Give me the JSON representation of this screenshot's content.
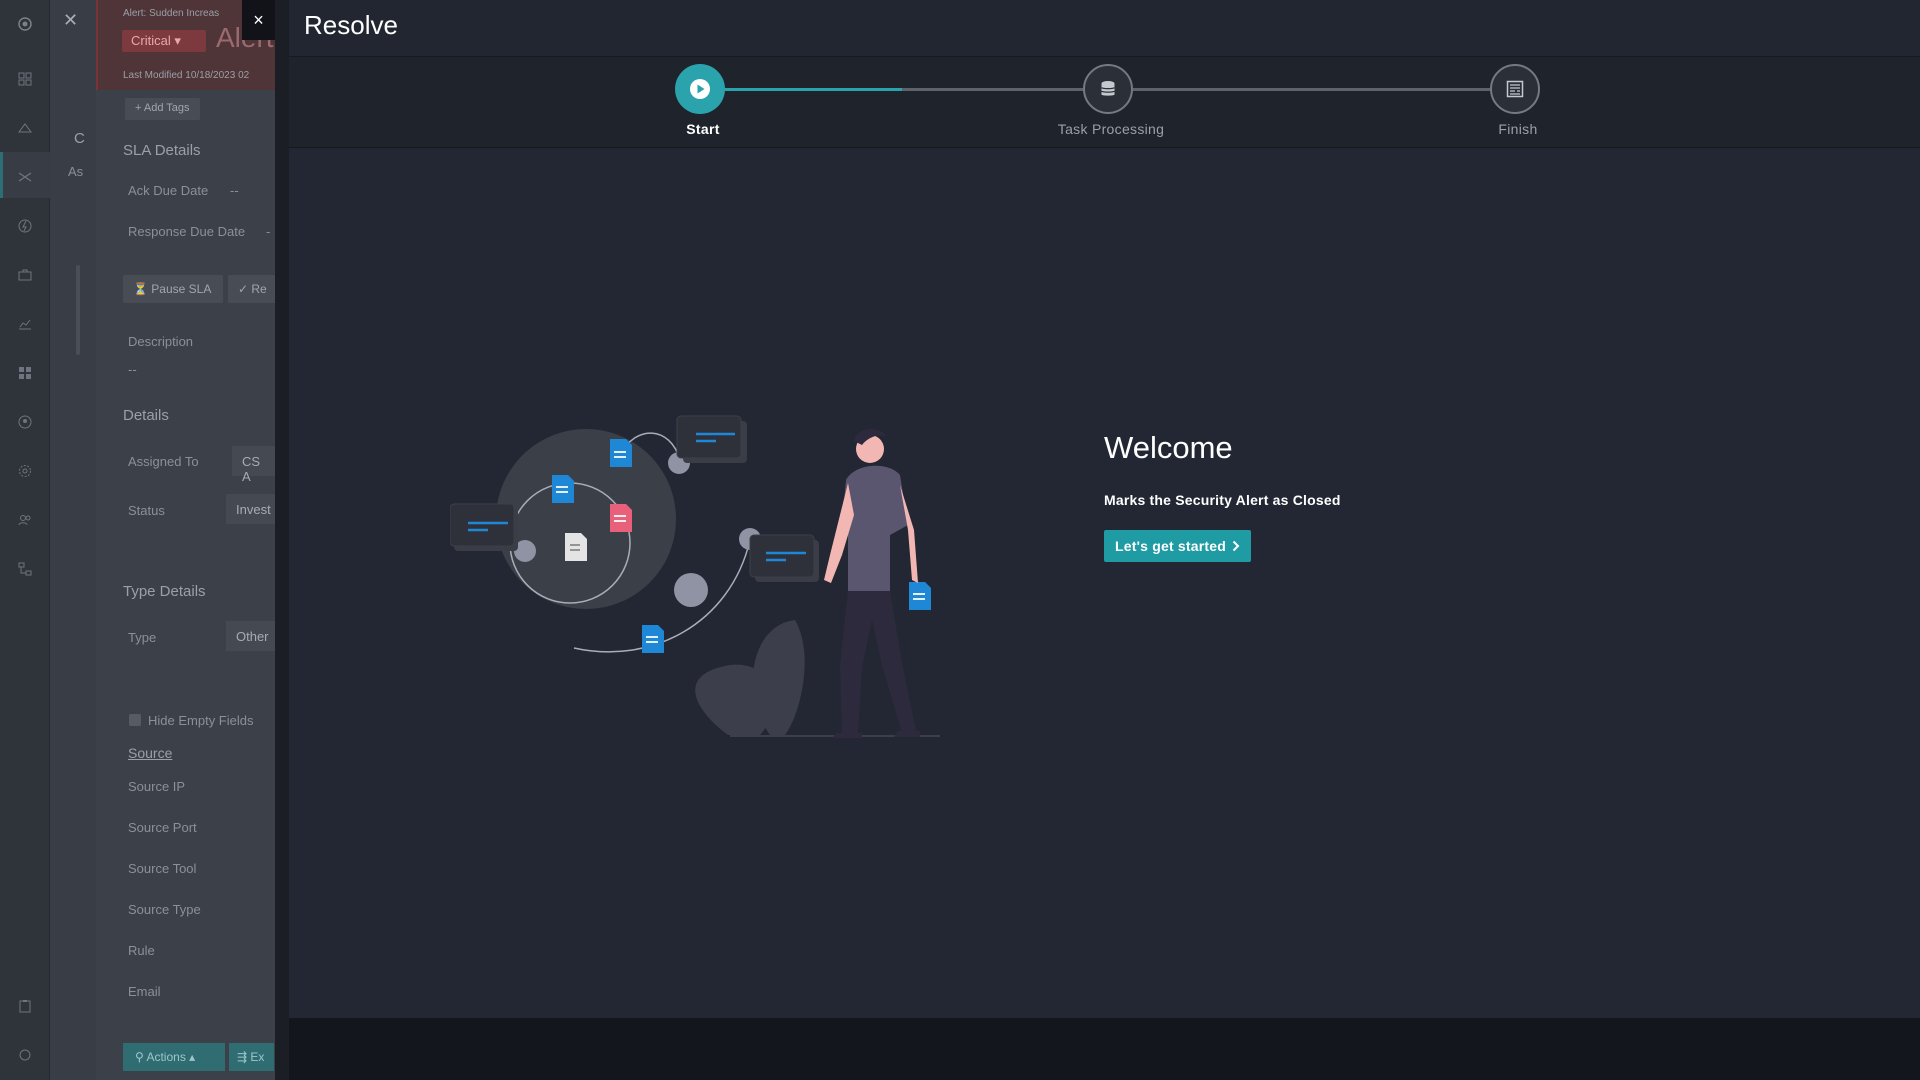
{
  "background": {
    "alert_title_prefix": "Alert: Sudden Increas",
    "severity_badge": "Critical",
    "alert_big_title": "Alert",
    "last_modified": "Last Modified 10/18/2023 02",
    "add_tags": "+ Add Tags",
    "tab_letter_c": "C",
    "tab_letter_as": "As",
    "sla_heading": "SLA Details",
    "ack_due_label": "Ack Due Date",
    "ack_due_value": "--",
    "response_due_label": "Response Due Date",
    "response_due_value": "-",
    "pause_sla": "Pause SLA",
    "resume_sla": "Re",
    "description_label": "Description",
    "description_value": "--",
    "details_heading": "Details",
    "assigned_to_label": "Assigned To",
    "assigned_to_value": "CS A",
    "status_label": "Status",
    "status_value": "Invest",
    "type_details_heading": "Type Details",
    "type_label": "Type",
    "type_value": "Other",
    "hide_empty_fields": "Hide Empty Fields",
    "source_tab": "Source",
    "source_fields": [
      "Source IP",
      "Source Port",
      "Source Tool",
      "Source Type",
      "Rule",
      "Email"
    ],
    "actions_button": "Actions",
    "ext_button": "Ex"
  },
  "drawer": {
    "title": "Resolve",
    "close_symbol": "×",
    "steps": [
      {
        "label": "Start",
        "icon": "play-icon",
        "state": "active"
      },
      {
        "label": "Task Processing",
        "icon": "database-icon",
        "state": "pending"
      },
      {
        "label": "Finish",
        "icon": "report-icon",
        "state": "pending"
      }
    ],
    "welcome": {
      "title": "Welcome",
      "description": "Marks the Security Alert as Closed",
      "start_button": "Let's get started"
    }
  },
  "colors": {
    "accent": "#2aa3ac",
    "drawer_bg": "#222733",
    "critical": "#7c3a3f",
    "illustration_blue": "#1e88d6",
    "illustration_pink": "#e8607a"
  }
}
